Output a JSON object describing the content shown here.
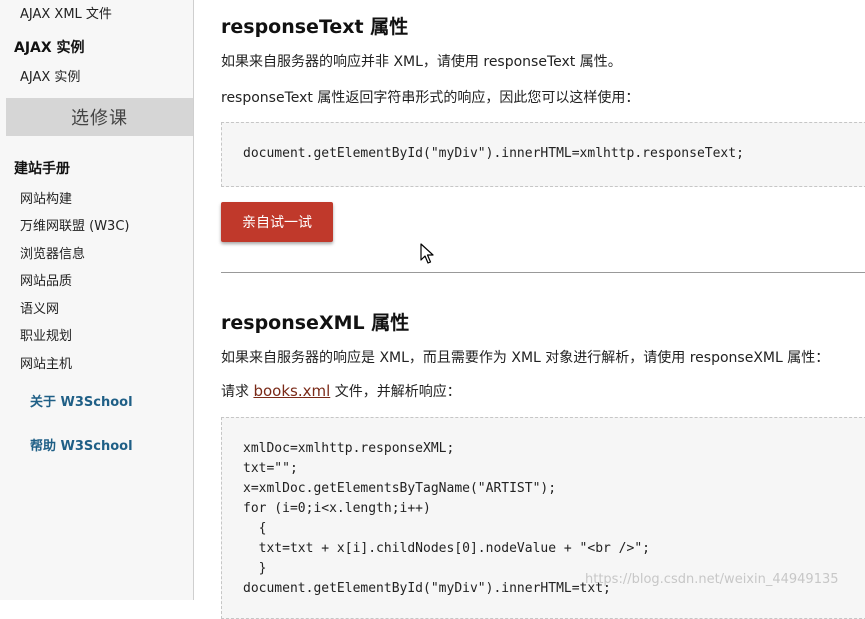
{
  "sidebar": {
    "ajax_xml_file": "AJAX XML 文件",
    "ajax_examples_heading": "AJAX 实例",
    "ajax_examples_link": "AJAX 实例",
    "elective": "选修课",
    "site_manual_heading": "建站手册",
    "manual_items": [
      "网站构建",
      "万维网联盟 (W3C)",
      "浏览器信息",
      "网站品质",
      "语义网",
      "职业规划",
      "网站主机"
    ],
    "about": "关于 W3School",
    "help": "帮助 W3School"
  },
  "main": {
    "section1": {
      "title": "responseText 属性",
      "para1": "如果来自服务器的响应并非 XML，请使用 responseText 属性。",
      "para2": "responseText 属性返回字符串形式的响应，因此您可以这样使用：",
      "code": "document.getElementById(\"myDiv\").innerHTML=xmlhttp.responseText;",
      "try_button": "亲自试一试"
    },
    "section2": {
      "title": "responseXML 属性",
      "para1": "如果来自服务器的响应是 XML，而且需要作为 XML 对象进行解析，请使用 responseXML 属性：",
      "para2_prefix": "请求",
      "para2_link": "books.xml",
      "para2_suffix": "文件，并解析响应：",
      "code_lines": [
        "xmlDoc=xmlhttp.responseXML;",
        "txt=\"\";",
        "x=xmlDoc.getElementsByTagName(\"ARTIST\");",
        "for (i=0;i<x.length;i++)",
        "  {",
        "  txt=txt + x[i].childNodes[0].nodeValue + \"<br />\";",
        "  }",
        "document.getElementById(\"myDiv\").innerHTML=txt;"
      ]
    }
  },
  "watermark": "https://blog.csdn.net/weixin_44949135"
}
